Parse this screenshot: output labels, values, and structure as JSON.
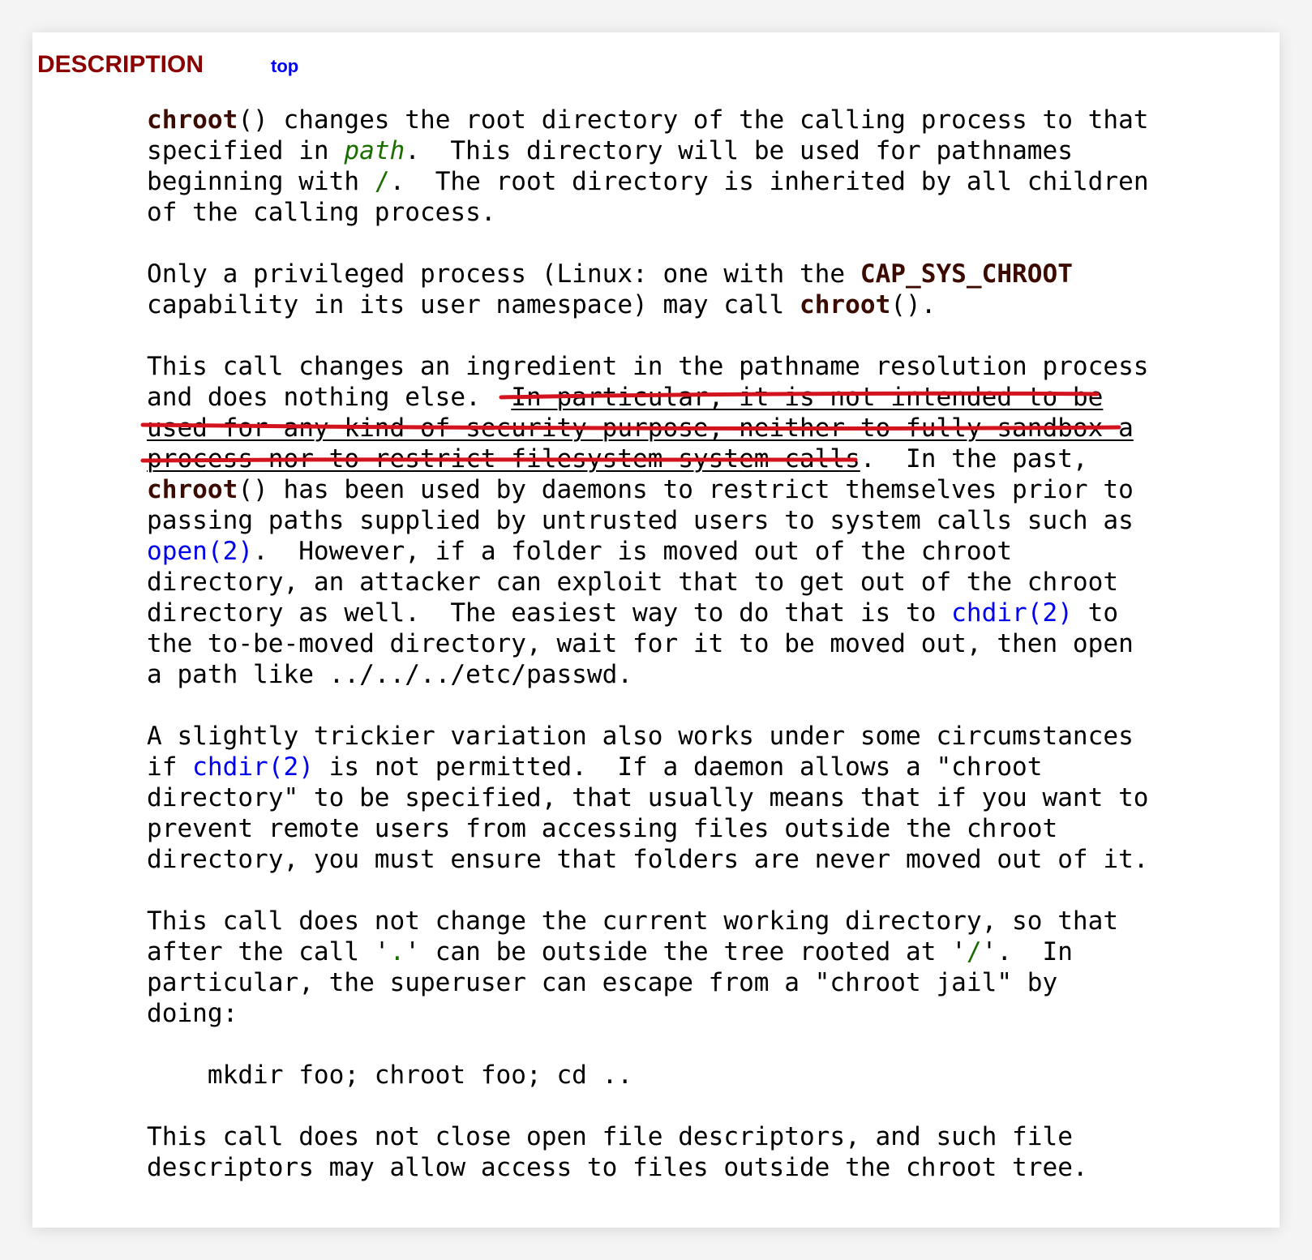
{
  "section": {
    "heading": "DESCRIPTION",
    "top_link": "top"
  },
  "p1": {
    "fn": "chroot",
    "t1": "() changes the root directory of the calling process to that\nspecified in ",
    "arg": "path",
    "t2": ".  This directory will be used for pathnames\nbeginning with ",
    "slash": "/",
    "t3": ".  The root directory is inherited by all children\nof the calling process."
  },
  "p2": {
    "t1": "Only a privileged process (Linux: one with the ",
    "cap": "CAP_SYS_CHROOT",
    "t2": "\ncapability in its user namespace) may call ",
    "fn": "chroot",
    "t3": "()."
  },
  "p3": {
    "t1": "This call changes an ingredient in the pathname resolution process\nand does nothing else.  ",
    "u1": "In particular, it is not intended to be",
    "nl1": "\n",
    "u2": "used for any kind of security purpose, neither to fully sandbox a",
    "nl2": "\n",
    "u3": "process nor to restrict filesystem system calls",
    "t2": ".  In the past,\n",
    "fn": "chroot",
    "t3": "() has been used by daemons to restrict themselves prior to\npassing paths supplied by untrusted users to system calls such as\n",
    "link_open": "open(2)",
    "t4": ".  However, if a folder is moved out of the chroot\ndirectory, an attacker can exploit that to get out of the chroot\ndirectory as well.  The easiest way to do that is to ",
    "link_chdir": "chdir(2)",
    "t5": " to\nthe to-be-moved directory, wait for it to be moved out, then open\na path like ../../../etc/passwd."
  },
  "p4": {
    "t1": "A slightly trickier variation also works under some circumstances\nif ",
    "link_chdir": "chdir(2)",
    "t2": " is not permitted.  If a daemon allows a \"chroot\ndirectory\" to be specified, that usually means that if you want to\nprevent remote users from accessing files outside the chroot\ndirectory, you must ensure that folders are never moved out of it."
  },
  "p5": {
    "t1": "This call does not change the current working directory, so that\nafter the call '",
    "dot": ".",
    "t2": "' can be outside the tree rooted at '",
    "slash": "/",
    "t3": "'.  In\nparticular, the superuser can escape from a \"chroot jail\" by\ndoing:"
  },
  "code": {
    "line": "    mkdir foo; chroot foo; cd .."
  },
  "p6": {
    "text": "This call does not close open file descriptors, and such file\ndescriptors may allow access to files outside the chroot tree."
  },
  "colors": {
    "heading": "#8b0000",
    "link": "#0000ee",
    "function_name": "#3b0a00",
    "argument": "#1a6e00",
    "annotation_stroke": "#d3141f"
  }
}
